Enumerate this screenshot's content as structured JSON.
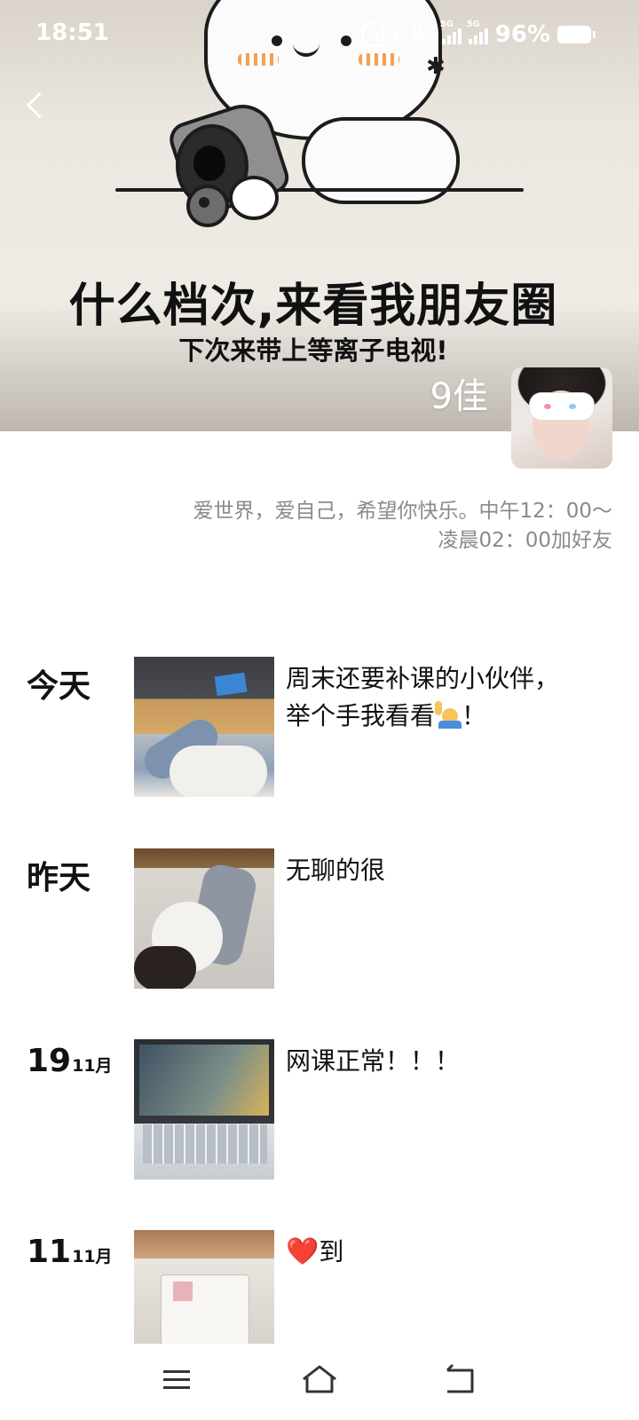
{
  "status_bar": {
    "time": "18:51",
    "net_speed_value": "18.4",
    "net_speed_unit": "KB/s",
    "sim1_tag": "5G",
    "sim2_tag": "5G",
    "battery": "96%"
  },
  "cover": {
    "title": "什么档次,来看我朋友圈",
    "subtitle": "下次来带上等离子电视!"
  },
  "profile": {
    "name": "9佳",
    "signature_line1": "爱世界，爱自己，希望你快乐。中午12：00～",
    "signature_line2": "凌晨02：00加好友"
  },
  "posts": [
    {
      "date": "今天",
      "text_line1": "周末还要补课的小伙伴，",
      "text_line2": "举个手我看看",
      "text_suffix": "！",
      "emoji": "person-raising-hand-emoji"
    },
    {
      "date": "昨天",
      "text": "无聊的很"
    },
    {
      "day": "19",
      "month": "11月",
      "text": "网课正常！！！"
    },
    {
      "day": "11",
      "month": "11月",
      "heart": "❤️",
      "text": "到"
    }
  ],
  "icons": {
    "back": "chevron-left-icon",
    "mute": "bell-off-icon",
    "bluetooth": "bluetooth-icon",
    "nav_menu": "menu-icon",
    "nav_home": "home-icon",
    "nav_back": "back-arrow-icon"
  }
}
